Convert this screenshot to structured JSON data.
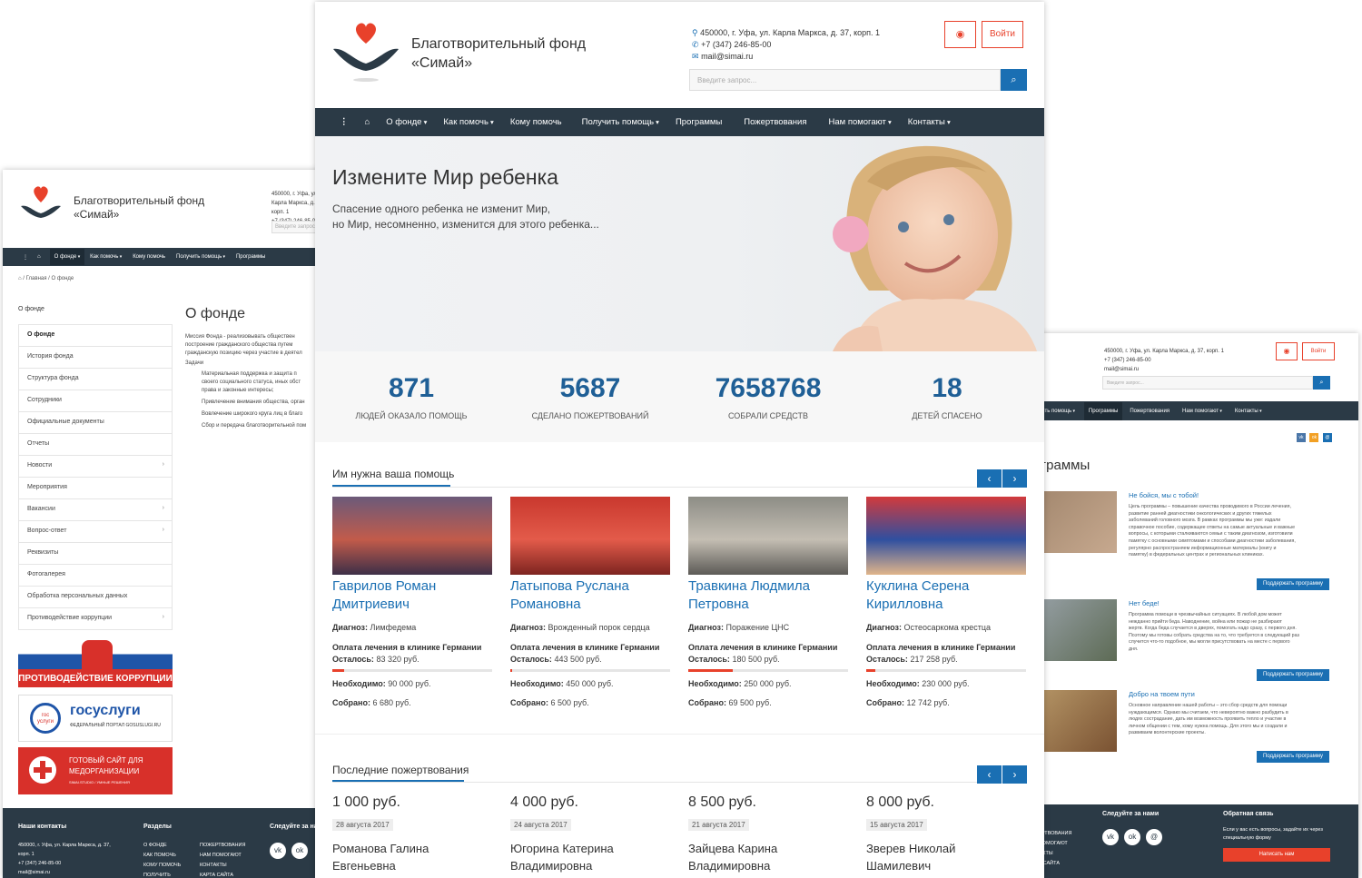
{
  "brand": {
    "name_line1": "Благотворительный фонд",
    "name_line2": "«Симай»"
  },
  "contacts": {
    "address": "450000, г. Уфа, ул. Карла Маркса, д. 37, корп. 1",
    "phone": "+7 (347) 246-85-00",
    "email": "mail@simai.ru"
  },
  "header": {
    "eye_icon": "eye-icon",
    "login_label": "Войти",
    "search_placeholder": "Введите запрос..."
  },
  "nav": {
    "items": [
      "О фонде",
      "Как помочь",
      "Кому помочь",
      "Получить помощь",
      "Программы",
      "Пожертвования",
      "Нам помогают",
      "Контакты"
    ]
  },
  "hero": {
    "title": "Измените Мир ребенка",
    "line1": "Спасение одного ребенка не изменит Мир,",
    "line2": "но Мир, несомненно, изменится для этого ребенка..."
  },
  "stats": [
    {
      "value": "871",
      "label": "людей оказало помощь"
    },
    {
      "value": "5687",
      "label": "сделано пожертвований"
    },
    {
      "value": "7658768",
      "label": "собрали средств"
    },
    {
      "value": "18",
      "label": "детей спасено"
    }
  ],
  "need_help": {
    "title": "Им нужна ваша помощь",
    "diag_label": "Диагноз:",
    "treat_label": "Оплата лечения в клинике Германии",
    "left_label": "Осталось:",
    "need_label": "Необходимо:",
    "got_label": "Собрано:",
    "cards": [
      {
        "name1": "Гаврилов Роман",
        "name2": "Дмитриевич",
        "diagnosis": "Лимфедема",
        "left": "83 320 руб.",
        "need": "90 000 руб.",
        "got": "6 680 руб.",
        "progress": 0.074
      },
      {
        "name1": "Латыпова Руслана",
        "name2": "Романовна",
        "diagnosis": "Врожденный порок сердца",
        "left": "443 500 руб.",
        "need": "450 000 руб.",
        "got": "6 500 руб.",
        "progress": 0.014
      },
      {
        "name1": "Травкина Людмила",
        "name2": "Петровна",
        "diagnosis": "Поражение ЦНС",
        "left": "180 500 руб.",
        "need": "250 000 руб.",
        "got": "69 500 руб.",
        "progress": 0.278
      },
      {
        "name1": "Куклина Серена",
        "name2": "Кирилловна",
        "diagnosis": "Остеосаркома крестца",
        "left": "217 258 руб.",
        "need": "230 000 руб.",
        "got": "12 742 руб.",
        "progress": 0.055
      }
    ]
  },
  "donations": {
    "title": "Последние пожертвования",
    "items": [
      {
        "amount": "1 000 руб.",
        "date": "28 августа 2017",
        "name1": "Романова Галина",
        "name2": "Евгеньевна"
      },
      {
        "amount": "4 000 руб.",
        "date": "24 августа 2017",
        "name1": "Югорина Катерина",
        "name2": "Владимировна"
      },
      {
        "amount": "8 500 руб.",
        "date": "21 августа 2017",
        "name1": "Зайцева Карина",
        "name2": "Владимировна"
      },
      {
        "amount": "8 000 руб.",
        "date": "15 августа 2017",
        "name1": "Зверев Николай",
        "name2": "Шамилевич"
      }
    ]
  },
  "left_page": {
    "breadcrumb_home": "Главная",
    "breadcrumb_current": "О фонде",
    "side_title": "О фонде",
    "page_title": "О фонде",
    "menu": [
      "О фонде",
      "История фонда",
      "Структура фонда",
      "Сотрудники",
      "Официальные документы",
      "Отчеты",
      "Новости",
      "Мероприятия",
      "Вакансии",
      "Вопрос-ответ",
      "Реквизиты",
      "Фотогалерея",
      "Обработка персональных данных",
      "Противодействие коррупции"
    ],
    "menu_chevrons": [
      false,
      false,
      false,
      false,
      false,
      false,
      true,
      false,
      true,
      true,
      false,
      false,
      false,
      true
    ],
    "body_p1": "Миссия Фонда - реализовывать общеcтвен",
    "body_p2": "построение гражданского общества путем",
    "body_p3": "гражданскую позицию через участие в деятел",
    "tasks_title": "Задачи",
    "tasks": [
      "Материальная поддержка и защита п",
      "своего социального статуса, иных обст",
      "права и законные интересы;",
      "Привлечение внимания общества, орган",
      "Вовлечение широкого круга лиц в благо",
      "Сбор и передача благотворительной пом"
    ],
    "banner1": "ПРОТИВОДЕЙСТВИЕ КОРРУПЦИИ",
    "banner2_title": "госуслуги",
    "banner2_sub": "ФЕДЕРАЛЬНЫЙ ПОРТАЛ GOSUSLUGI.RU",
    "banner2_logo": "гос услуги",
    "banner3_l1": "ГОТОВЫЙ САЙТ ДЛЯ",
    "banner3_l2": "МЕДОРГАНИЗАЦИИ",
    "banner3_sub": "SIMAI.STUDIO / УМНЫЕ РЕШЕНИЯ",
    "footer": {
      "contacts_title": "Наши контакты",
      "sections_title": "Разделы",
      "follow_title": "Следуйте за нами",
      "addr1": "450000, г. Уфа, ул. Карла Маркса, д. 37,",
      "addr2": "корп. 1",
      "phone": "+7 (347) 246-85-00",
      "email": "mail@simai.ru",
      "col1": [
        "О ФОНДЕ",
        "КАК ПОМОЧЬ",
        "КОМУ ПОМОЧЬ",
        "ПОЛУЧИТЬ"
      ],
      "col2": [
        "ПОЖЕРТВОВАНИЯ",
        "НАМ ПОМОГАЮТ",
        "КОНТАКТЫ",
        "КАРТА САЙТА"
      ]
    }
  },
  "right_page": {
    "title": "рограммы",
    "support_label": "Поддержать программу",
    "programs": [
      {
        "title": "Не бойся, мы с тобой!",
        "text": [
          "Цель программы – повышение качества проводимого в России лечения,",
          "развитие ранней диагностики онкологических и других тяжелых",
          "заболеваний головного мозга. В рамках программы мы уже: издали",
          "справочное пособие, содержащее ответы на самые актуальные и важные",
          "вопросы, с которыми сталкиваются семьи с таким диагнозом, изготовили",
          "памятку с основными симптомами и способами диагностики заболевания,",
          "регулярно распространяем информационные материалы (книгу и",
          "памятку) в федеральных центрах и региональных клиниках."
        ]
      },
      {
        "title": "Нет беде!",
        "text": [
          "Программа помощи в чрезвычайных ситуациях. В любой дом может",
          "нежданно прийти беда. Наводнение, война или пожар не разбирают",
          "жертв. Когда беда случается в дверях, помогать надо сразу, с первого дня.",
          "Поэтому мы готовы собрать средства на то, что требуется в следующий раз",
          "случится что-то подобное, мы могли присутствовать на месте с первого",
          "дня."
        ]
      },
      {
        "title": "Добро на твоем пути",
        "text": [
          "Основное направление нашей работы – это сбор средств для помощи",
          "нуждающимся. Однако мы считаем, что невероятно важно разбудить в",
          "людях сострадание, дать им возможность проявить тепло и участие в",
          "личном общении с тем, кому нужна помощь. Для этого мы и создали и",
          "развиваем волонтерские проекты."
        ]
      }
    ],
    "nav": [
      "Получить помощь",
      "Программы",
      "Пожертвования",
      "Нам помогают",
      "Контакты"
    ],
    "footer": {
      "follow": "Следуйте за нами",
      "feedback": "Обратная связь",
      "fb_text1": "Если у вас есть вопросы, задайте их через",
      "fb_text2": "специальную форму",
      "write_label": "Написать нам",
      "col": [
        "ПОЖЕРТВОВАНИЯ",
        "НАМ ПОМОГАЮТ",
        "КОНТАКТЫ",
        "КАРТА САЙТА"
      ]
    }
  },
  "colors": {
    "accent": "#1a6fb3",
    "brand_red": "#e8412b",
    "nav_bg": "#2b3a46"
  }
}
